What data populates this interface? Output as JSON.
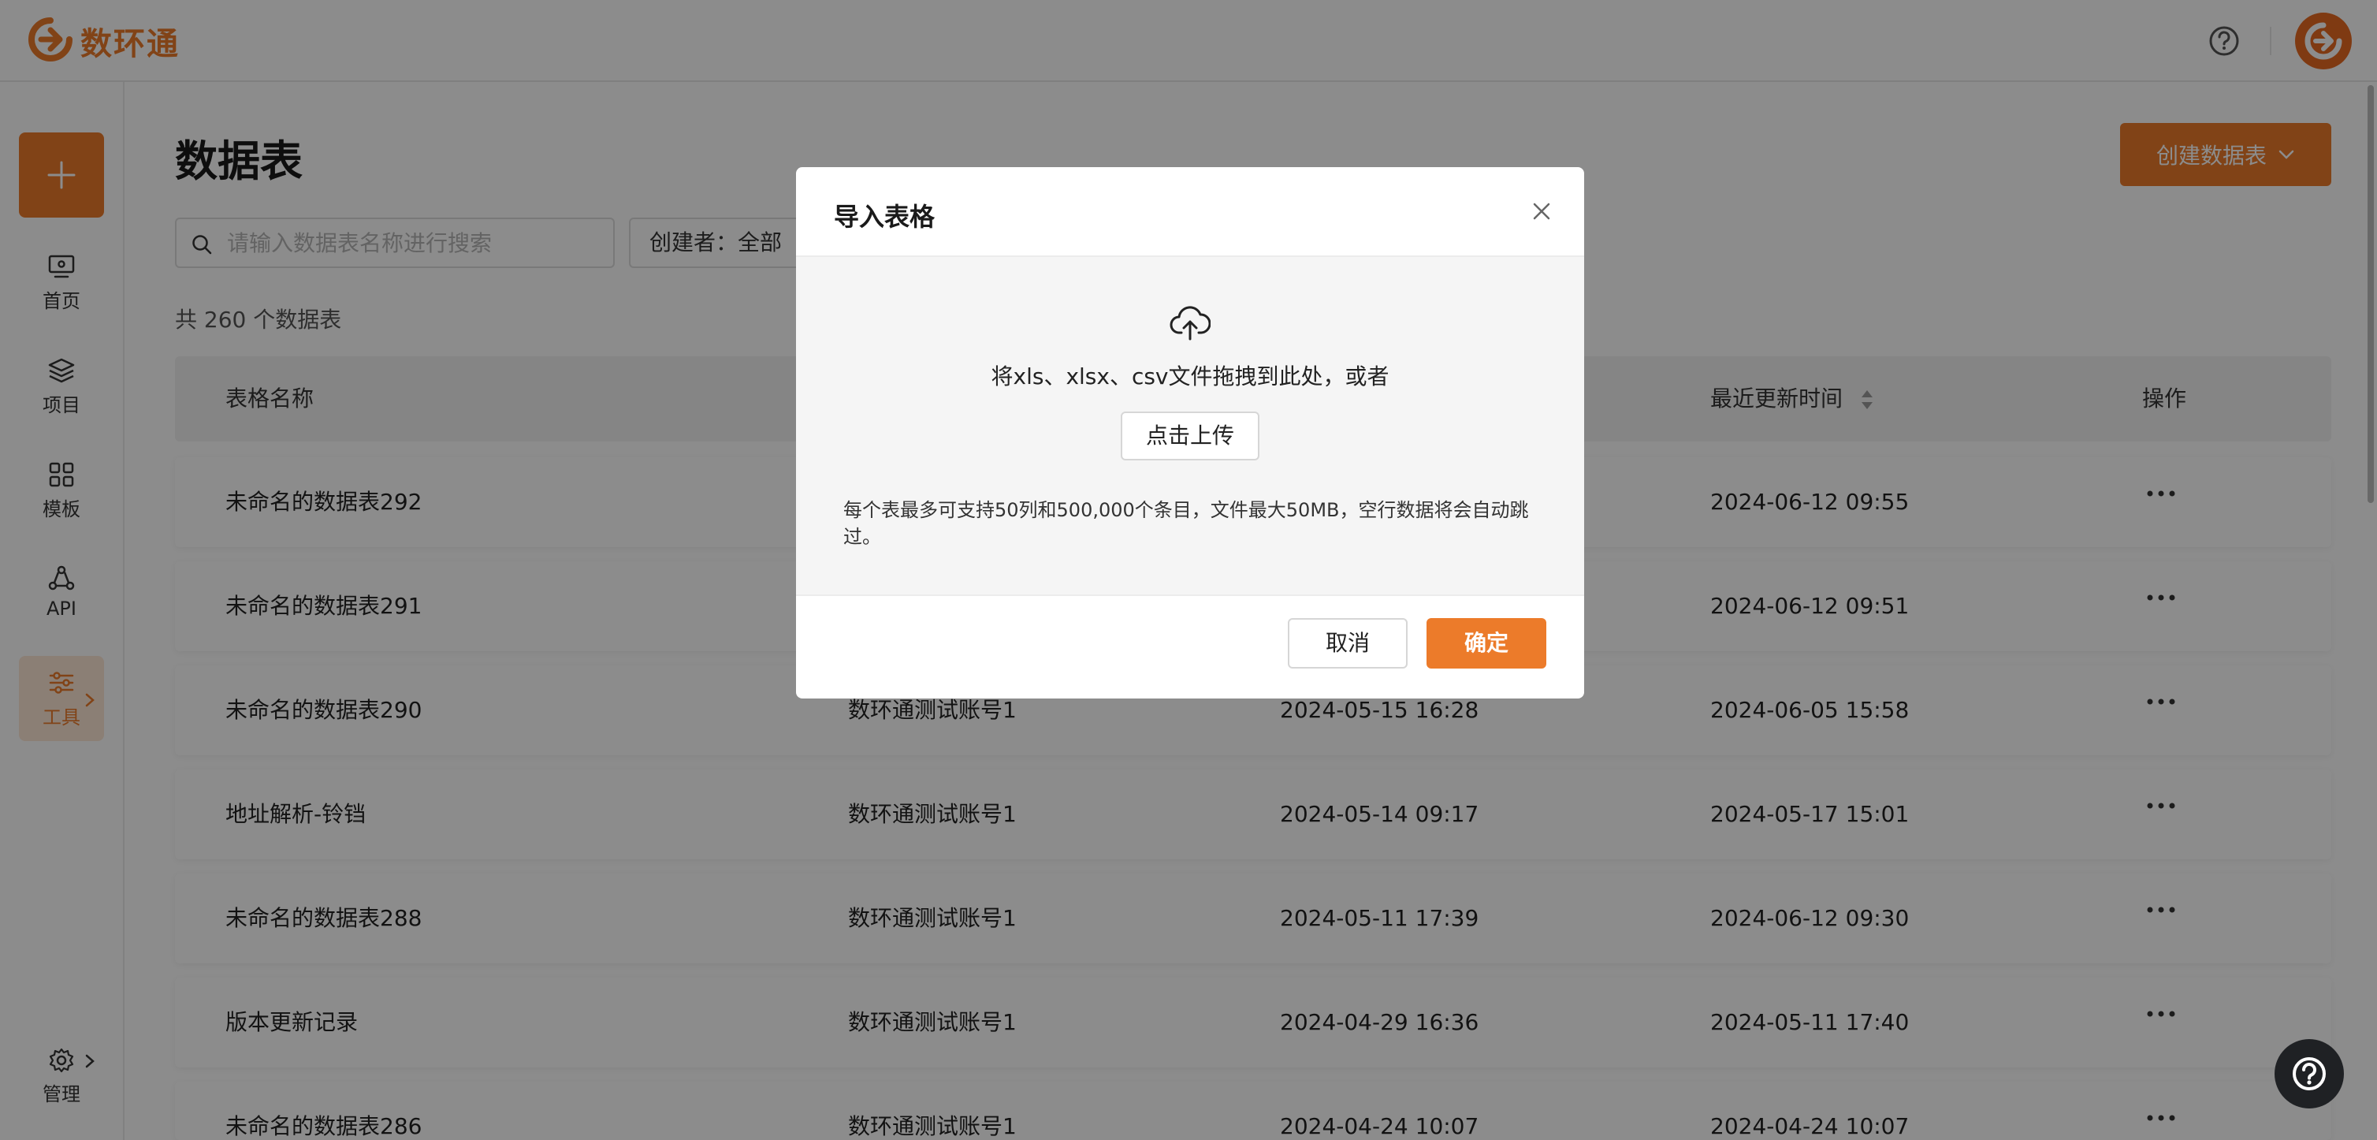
{
  "app": {
    "logo_text": "数环通"
  },
  "colors": {
    "accent": "#ec7b2a",
    "overlay": "rgba(0,0,0,0.45)"
  },
  "sidebar": {
    "create_icon": "plus-icon",
    "items": [
      {
        "label": "首页",
        "icon": "monitor-icon"
      },
      {
        "label": "项目",
        "icon": "layers-icon"
      },
      {
        "label": "模板",
        "icon": "grid-icon"
      },
      {
        "label": "API",
        "icon": "api-icon"
      },
      {
        "label": "工具",
        "icon": "sliders-icon",
        "active": true
      }
    ],
    "manage_label": "管理"
  },
  "main": {
    "title": "数据表",
    "create_button": "创建数据表",
    "search_placeholder": "请输入数据表名称进行搜索",
    "creator_filter": "创建者：全部",
    "total": "共 260 个数据表",
    "columns": {
      "name": "表格名称",
      "updated": "最近更新时间",
      "actions": "操作"
    },
    "rows": [
      {
        "name": "未命名的数据表292",
        "creator": "",
        "created": "",
        "updated": "2024-06-12 09:55"
      },
      {
        "name": "未命名的数据表291",
        "creator": "",
        "created": "",
        "updated": "2024-06-12 09:51"
      },
      {
        "name": "未命名的数据表290",
        "creator": "数环通测试账号1",
        "created": "2024-05-15 16:28",
        "updated": "2024-06-05 15:58"
      },
      {
        "name": "地址解析-铃铛",
        "creator": "数环通测试账号1",
        "created": "2024-05-14 09:17",
        "updated": "2024-05-17 15:01"
      },
      {
        "name": "未命名的数据表288",
        "creator": "数环通测试账号1",
        "created": "2024-05-11 17:39",
        "updated": "2024-06-12 09:30"
      },
      {
        "name": "版本更新记录",
        "creator": "数环通测试账号1",
        "created": "2024-04-29 16:36",
        "updated": "2024-05-11 17:40"
      },
      {
        "name": "未命名的数据表286",
        "creator": "数环通测试账号1",
        "created": "2024-04-24 10:07",
        "updated": "2024-04-24 10:07"
      }
    ]
  },
  "modal": {
    "title": "导入表格",
    "drop_text": "将xls、xlsx、csv文件拖拽到此处，或者",
    "upload_button": "点击上传",
    "limits_note": "每个表最多可支持50列和500,000个条目，文件最大50MB，空行数据将会自动跳过。",
    "cancel": "取消",
    "confirm": "确定"
  }
}
